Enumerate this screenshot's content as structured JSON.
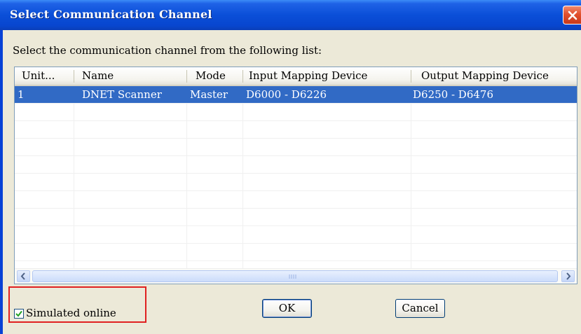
{
  "window": {
    "title": "Select Communication Channel",
    "close_icon": "close-icon"
  },
  "instruction": "Select the communication channel from the following list:",
  "table": {
    "columns": [
      "Unit...",
      "Name",
      "Mode",
      "Input Mapping Device",
      "Output Mapping Device"
    ],
    "rows": [
      [
        "1",
        "DNET Scanner",
        "Master",
        "D6000 - D6226",
        "D6250 - D6476"
      ]
    ],
    "selected_row": 0
  },
  "options": {
    "simulated_online_label": "Simulated online",
    "simulated_online_checked": true
  },
  "buttons": {
    "ok_label": "OK",
    "cancel_label": "Cancel"
  },
  "colors": {
    "title_bar": "#0A4FD8",
    "selection": "#316AC5",
    "highlight_box": "#E02020"
  }
}
